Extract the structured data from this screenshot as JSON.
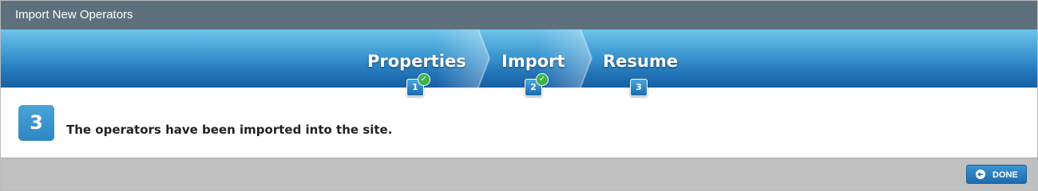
{
  "window": {
    "title": "Import New Operators"
  },
  "wizard": {
    "steps": [
      {
        "label": "Properties",
        "number": "1",
        "completed": true
      },
      {
        "label": "Import",
        "number": "2",
        "completed": true
      },
      {
        "label": "Resume",
        "number": "3",
        "completed": false
      }
    ],
    "current_step": "3"
  },
  "content": {
    "message": "The operators have been imported into the site."
  },
  "footer": {
    "done_label": "DONE",
    "done_icon": "arrow-left-circle-icon"
  },
  "colors": {
    "titlebar": "#5e707c",
    "accent": "#2f86c4",
    "success": "#3cb24a",
    "footer": "#c0c0c0"
  }
}
